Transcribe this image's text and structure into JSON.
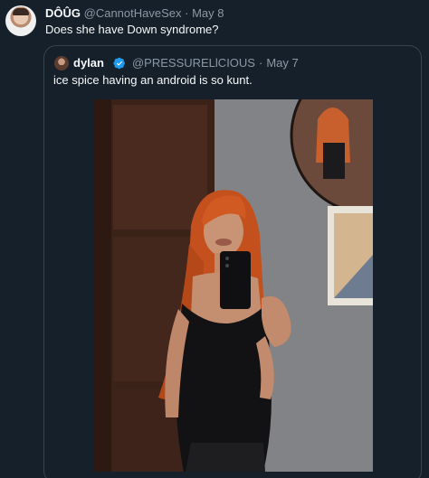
{
  "tweet": {
    "author_name": "DÔÛG",
    "author_handle": "@CannotHaveSex",
    "separator": "·",
    "date": "May 8",
    "text": "Does she have Down syndrome?"
  },
  "quoted_tweet": {
    "author_name": "dylan",
    "author_handle": "@PRESSURELlCIOUS",
    "separator": "·",
    "date": "May 7",
    "text": "ice spice having an android is so kunt.",
    "verified": true
  },
  "colors": {
    "background": "#15202b",
    "text": "#f7f9f9",
    "muted": "#8b98a5",
    "border": "#38444d",
    "verified_badge": "#1d9bf0"
  },
  "icons": [
    "profile-avatar",
    "verified-badge-icon"
  ]
}
